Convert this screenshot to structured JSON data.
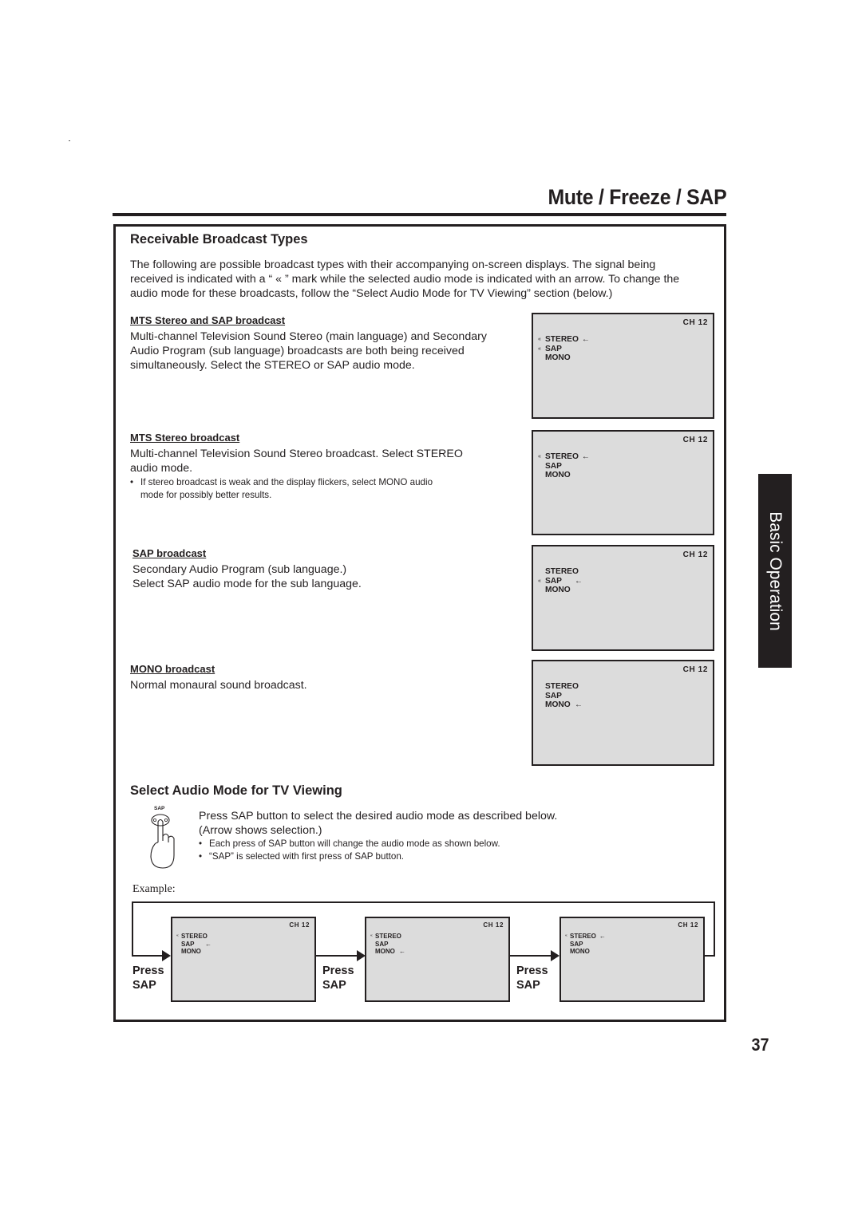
{
  "page": {
    "title": "Mute / Freeze / SAP",
    "side_tab": "Basic Operation",
    "page_number": "37"
  },
  "receivable": {
    "heading": "Receivable Broadcast Types",
    "intro_lines": [
      "The following are possible broadcast types with their accompanying on-screen displays. The signal being",
      "received is indicated with a “ « ” mark while the selected audio mode is indicated with an arrow. To change the",
      "audio mode for these broadcasts, follow the “Select Audio Mode for TV Viewing” section (below.)"
    ],
    "sections": [
      {
        "title": "MTS Stereo and SAP broadcast",
        "lines": [
          "Multi-channel Television Sound Stereo (main language) and Secondary",
          "Audio Program (sub language) broadcasts are both being received",
          "simultaneously. Select the STEREO or SAP audio mode."
        ],
        "note_lines": [],
        "osd": {
          "channel": "CH  12",
          "rows": [
            {
              "label": "STEREO",
              "signal": true,
              "selected": true
            },
            {
              "label": "SAP",
              "signal": true,
              "selected": false
            },
            {
              "label": "MONO",
              "signal": false,
              "selected": false
            }
          ]
        }
      },
      {
        "title": "MTS Stereo broadcast",
        "lines": [
          "Multi-channel Television Sound Stereo broadcast. Select STEREO",
          "audio mode."
        ],
        "note_lines": [
          "If stereo broadcast is weak and the display flickers, select MONO audio",
          "mode for possibly better results."
        ],
        "osd": {
          "channel": "CH  12",
          "rows": [
            {
              "label": "STEREO",
              "signal": true,
              "selected": true
            },
            {
              "label": "SAP",
              "signal": false,
              "selected": false
            },
            {
              "label": "MONO",
              "signal": false,
              "selected": false
            }
          ]
        }
      },
      {
        "title": "SAP broadcast",
        "lines": [
          "Secondary Audio Program (sub language.)",
          "Select SAP audio mode for the sub language."
        ],
        "note_lines": [],
        "osd": {
          "channel": "CH  12",
          "rows": [
            {
              "label": "STEREO",
              "signal": false,
              "selected": false
            },
            {
              "label": "SAP",
              "signal": true,
              "selected": true
            },
            {
              "label": "MONO",
              "signal": false,
              "selected": false
            }
          ]
        }
      },
      {
        "title": "MONO broadcast",
        "lines": [
          "Normal monaural sound broadcast."
        ],
        "note_lines": [],
        "osd": {
          "channel": "CH  12",
          "rows": [
            {
              "label": "STEREO",
              "signal": false,
              "selected": false
            },
            {
              "label": "SAP",
              "signal": false,
              "selected": false
            },
            {
              "label": "MONO",
              "signal": false,
              "selected": true
            }
          ]
        }
      }
    ]
  },
  "select_mode": {
    "heading": "Select Audio Mode for TV Viewing",
    "button_label": "SAP",
    "lines": [
      "Press SAP button to select the desired audio mode as described below.",
      "(Arrow shows selection.)"
    ],
    "bullets": [
      "Each press of SAP button will change the audio mode as shown below.",
      "“SAP” is selected with first press of SAP button."
    ],
    "example_label": "Example:",
    "press_label": [
      "Press",
      "SAP"
    ],
    "steps": [
      {
        "channel": "CH  12",
        "rows": [
          {
            "label": "STEREO",
            "signal": true,
            "selected": false
          },
          {
            "label": "SAP",
            "signal": false,
            "selected": true
          },
          {
            "label": "MONO",
            "signal": false,
            "selected": false
          }
        ]
      },
      {
        "channel": "CH  12",
        "rows": [
          {
            "label": "STEREO",
            "signal": true,
            "selected": false
          },
          {
            "label": "SAP",
            "signal": false,
            "selected": false
          },
          {
            "label": "MONO",
            "signal": false,
            "selected": true
          }
        ]
      },
      {
        "channel": "CH  12",
        "rows": [
          {
            "label": "STEREO",
            "signal": true,
            "selected": true
          },
          {
            "label": "SAP",
            "signal": false,
            "selected": false
          },
          {
            "label": "MONO",
            "signal": false,
            "selected": false
          }
        ]
      }
    ]
  },
  "icons": {
    "signal": "«",
    "selection_arrow": "←"
  }
}
